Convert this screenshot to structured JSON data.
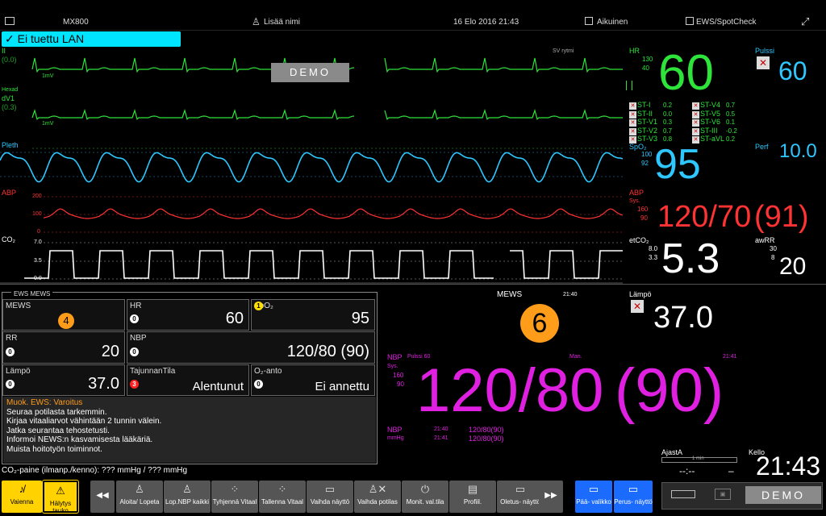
{
  "topbar": {
    "device": "MX800",
    "patient_name": "Lisää nimi",
    "datetime": "16 Elo 2016 21:43",
    "patient_category": "Aikuinen",
    "profile": "EWS/SpotCheck"
  },
  "alert": {
    "lan": "✓ Ei tuettu LAN"
  },
  "waves": {
    "ecg1_label": "II",
    "ecg1_offset": "(0.0)",
    "ecg1_scale": "1mV",
    "rhythm": "SV rytmi",
    "demo": "DEMO",
    "ecg2_tag": "Hexad",
    "ecg2_label": "dV1",
    "ecg2_offset": "(0.3)",
    "ecg2_scale": "1mV",
    "pleth_label": "Pleth",
    "abp_label": "ABP",
    "abp_scale_high": "200",
    "abp_scale_mid": "100",
    "abp_scale_low": "0",
    "co2_label": "CO₂",
    "co2_scale_high": "7.0",
    "co2_scale_mid": "3.5",
    "co2_scale_low": "0.0"
  },
  "vitals": {
    "hr_label": "HR",
    "hr_high": "130",
    "hr_low": "40",
    "hr_value": "60",
    "pulse_label": "Pulssi",
    "pulse_value": "60",
    "st": [
      {
        "name": "ST-I",
        "value": "0.2"
      },
      {
        "name": "ST-II",
        "value": "0.0"
      },
      {
        "name": "ST-V1",
        "value": "0.3"
      },
      {
        "name": "ST-V2",
        "value": "0.7"
      },
      {
        "name": "ST-V3",
        "value": "0.8"
      },
      {
        "name": "ST-V4",
        "value": "0.7"
      },
      {
        "name": "ST-V5",
        "value": "0.5"
      },
      {
        "name": "ST-V6",
        "value": "0.1"
      },
      {
        "name": "ST-III",
        "value": "-0.2"
      },
      {
        "name": "ST-aVL",
        "value": "0.2"
      }
    ],
    "spo2_label": "SpO₂",
    "spo2_high": "100",
    "spo2_low": "92",
    "spo2_value": "95",
    "perf_label": "Perf",
    "perf_value": "10.0",
    "abp_label": "ABP",
    "abp_sys": "Sys.",
    "abp_high": "160",
    "abp_low": "90",
    "abp_value": "120/70",
    "abp_mean": "(91)",
    "etco2_label": "etCO₂",
    "etco2_high": "8.0",
    "etco2_low": "3.3",
    "etco2_value": "5.3",
    "awrr_label": "awRR",
    "awrr_high": "30",
    "awrr_low": "8",
    "awrr_value": "20",
    "temp_label": "Lämpö",
    "temp_value": "37.0"
  },
  "ews": {
    "title": "EWS  MEWS",
    "cells": {
      "mews_label": "MEWS",
      "mews_score": "4",
      "hr_label": "HR",
      "hr_score": "0",
      "hr_value": "60",
      "spo2_label": "SpO₂",
      "spo2_score": "1",
      "spo2_value": "95",
      "rr_label": "RR",
      "rr_score": "0",
      "rr_value": "20",
      "nbp_label": "NBP",
      "nbp_score": "0",
      "nbp_value": "120/80 (90)",
      "temp_label": "Lämpö",
      "temp_score": "0",
      "temp_value": "37.0",
      "con_label": "TajunnanTila",
      "con_score": "3",
      "con_value": "Alentunut",
      "o2_label": "O₂-anto",
      "o2_score": "0",
      "o2_value": "Ei annettu"
    },
    "message_header": "Muok. EWS: Varoitus",
    "message_lines": [
      "Seuraa potilasta tarkemmin.",
      "Kirjaa vitaaliarvot vähintään 2 tunnin välein.",
      "Jatka seurantaa tehostetusti.",
      "Informoi NEWS:n kasvamisesta lääkäriä.",
      "Muista hoitotyön toiminnot."
    ]
  },
  "mews_big": {
    "label": "MEWS",
    "time": "21:40",
    "value": "6"
  },
  "nbp": {
    "label": "NBP",
    "pulse": "Pulssi 60",
    "mode": "Man.",
    "time": "21:41",
    "sys": "Sys.",
    "high": "160",
    "low": "90",
    "value": "120/80",
    "mean": "(90)",
    "history_label": "NBP",
    "unit": "mmHg",
    "history": [
      {
        "time": "21:40",
        "value": "120/80(90)"
      },
      {
        "time": "21:41",
        "value": "120/80(90)"
      }
    ]
  },
  "timer": {
    "label": "AjastA",
    "scale": "1 min",
    "value": "--:--"
  },
  "clock": {
    "label": "Kello",
    "value": "21:43"
  },
  "co2_pressure": "CO₂-paine (ilmanp./kenno): ??? mmHg / ??? mmHg",
  "buttons": {
    "silence": "Vaienna",
    "pause": "Hälytys tauko",
    "prev": "◀◀",
    "start_stop": "Aloita/ Lopeta",
    "nbp_all": "Lop.NBP kaikki",
    "clear_vitals": "Tyhjennä Vitaal",
    "save_vitals": "Tallenna Vitaal",
    "change_screen": "Vaihda näyttö",
    "change_patient": "Vaihda potilas",
    "monitor_mode": "Monit. val.tila",
    "profiles": "Profiil.",
    "default_screen": "Oletus- näyttö",
    "next": "▶▶",
    "main_menu": "Pää- valikko",
    "basic_screen": "Perus- näyttö",
    "demo": "DEMO"
  }
}
